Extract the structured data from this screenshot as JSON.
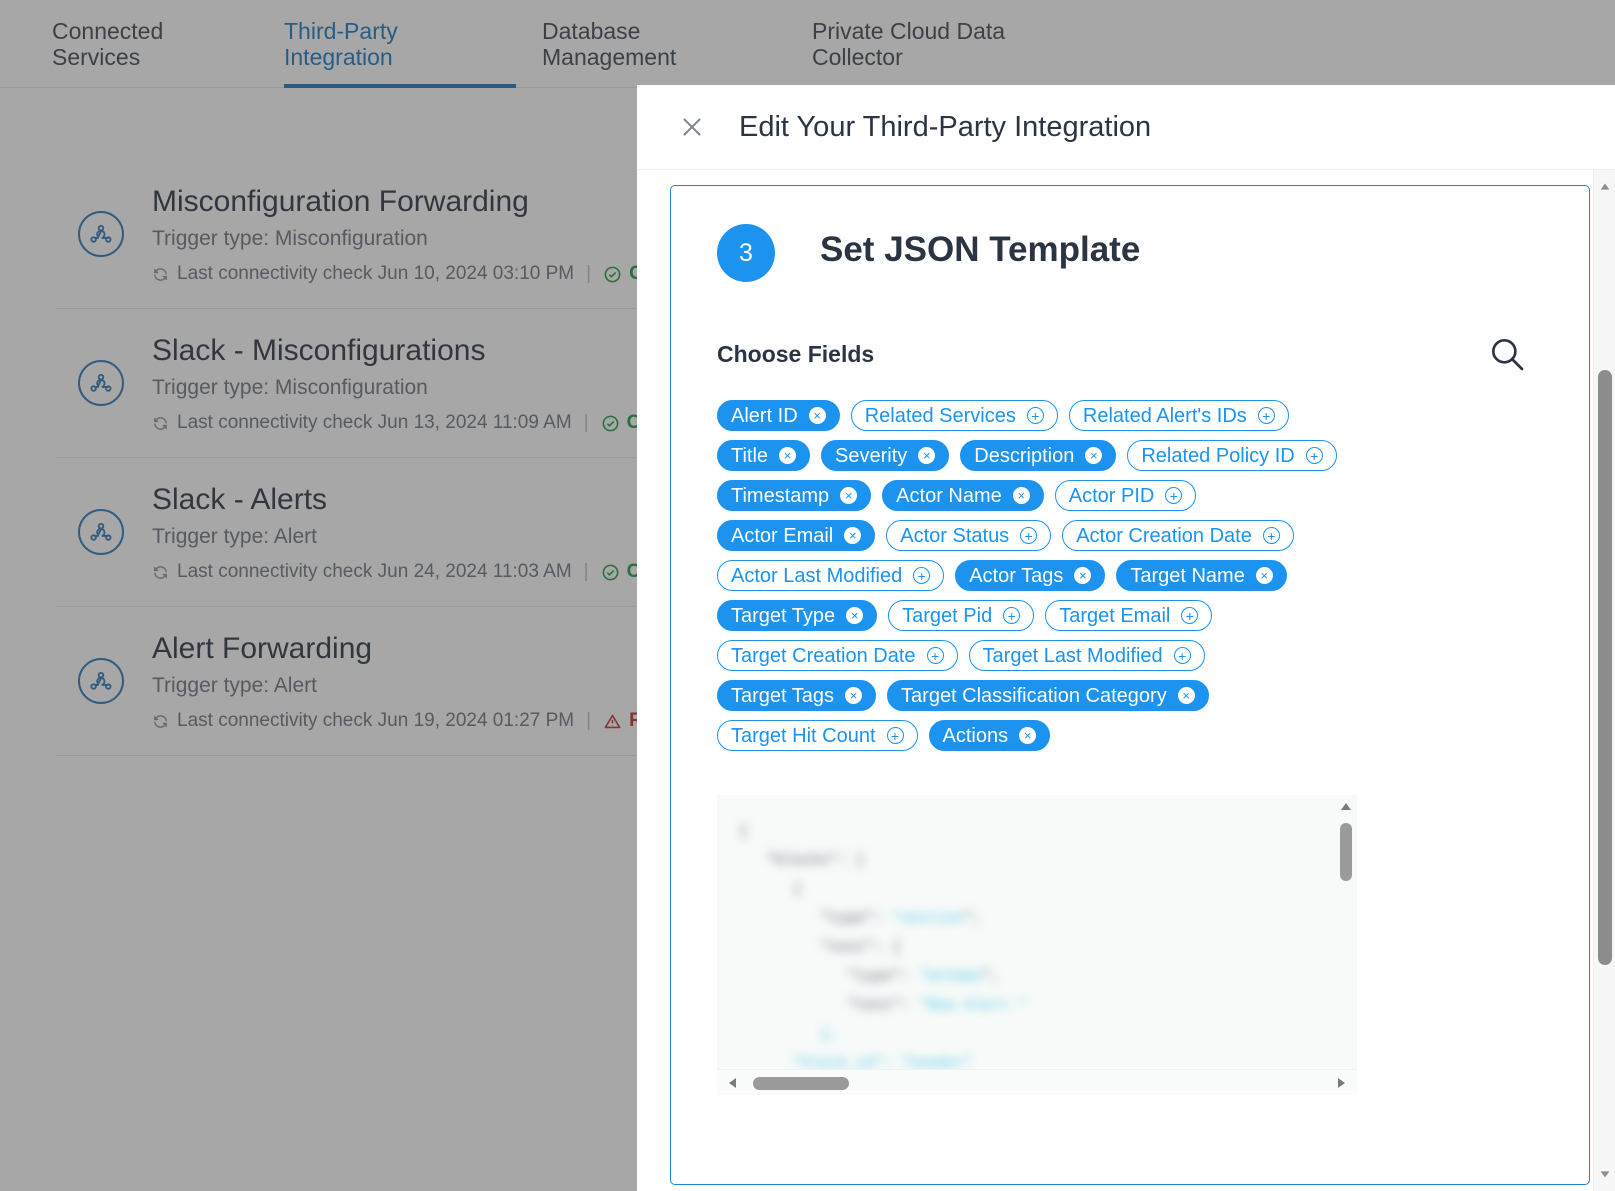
{
  "tabs": [
    {
      "label": "Connected\nServices",
      "active": false
    },
    {
      "label": "Third-Party\nIntegration",
      "active": true
    },
    {
      "label": "Database\nManagement",
      "active": false
    },
    {
      "label": "Private Cloud Data\nCollector",
      "active": false
    }
  ],
  "integration_list": [
    {
      "name": "Misconfiguration Forwarding",
      "trigger": "Trigger type: Misconfiguration",
      "check": "Last connectivity check Jun 10, 2024 03:10 PM",
      "status": "Conn",
      "status_kind": "ok"
    },
    {
      "name": "Slack - Misconfigurations",
      "trigger": "Trigger type: Misconfiguration",
      "check": "Last connectivity check Jun 13, 2024 11:09 AM",
      "status": "Conn",
      "status_kind": "ok"
    },
    {
      "name": "Slack - Alerts",
      "trigger": "Trigger type: Alert",
      "check": "Last connectivity check Jun 24, 2024 11:03 AM",
      "status": "Conn",
      "status_kind": "ok"
    },
    {
      "name": "Alert Forwarding",
      "trigger": "Trigger type: Alert",
      "check": "Last connectivity check Jun 19, 2024 01:27 PM",
      "status": "Requ",
      "status_kind": "err"
    }
  ],
  "modal": {
    "title": "Edit Your Third-Party Integration",
    "step_number": "3",
    "step_title": "Set JSON Template",
    "choose_fields_label": "Choose Fields",
    "fields": [
      {
        "label": "Alert ID",
        "selected": true
      },
      {
        "label": "Related Services",
        "selected": false
      },
      {
        "label": "Related Alert's IDs",
        "selected": false
      },
      {
        "label": "Title",
        "selected": true
      },
      {
        "label": "Severity",
        "selected": true
      },
      {
        "label": "Description",
        "selected": true
      },
      {
        "label": "Related Policy ID",
        "selected": false
      },
      {
        "label": "Timestamp",
        "selected": true
      },
      {
        "label": "Actor Name",
        "selected": true
      },
      {
        "label": "Actor PID",
        "selected": false
      },
      {
        "label": "Actor Email",
        "selected": true
      },
      {
        "label": "Actor Status",
        "selected": false
      },
      {
        "label": "Actor Creation Date",
        "selected": false
      },
      {
        "label": "Actor Last Modified",
        "selected": false
      },
      {
        "label": "Actor Tags",
        "selected": true
      },
      {
        "label": "Target Name",
        "selected": true
      },
      {
        "label": "Target Type",
        "selected": true
      },
      {
        "label": "Target Pid",
        "selected": false
      },
      {
        "label": "Target Email",
        "selected": false
      },
      {
        "label": "Target Creation Date",
        "selected": false
      },
      {
        "label": "Target Last Modified",
        "selected": false
      },
      {
        "label": "Target Tags",
        "selected": true
      },
      {
        "label": "Target Classification Category",
        "selected": true
      },
      {
        "label": "Target Hit Count",
        "selected": false
      },
      {
        "label": "Actions",
        "selected": true
      }
    ],
    "remove_glyph": "×",
    "add_glyph": "+",
    "editor_code": "{\n   \"blocks\": [\n      {\n         \"type\": \"section\",\n         \"text\": {\n            \"type\": \"mrkdwn\",\n            \"text\": \"New Alert *<https://app.service.co\n         },\n      \"block_id\": \"header\""
  }
}
